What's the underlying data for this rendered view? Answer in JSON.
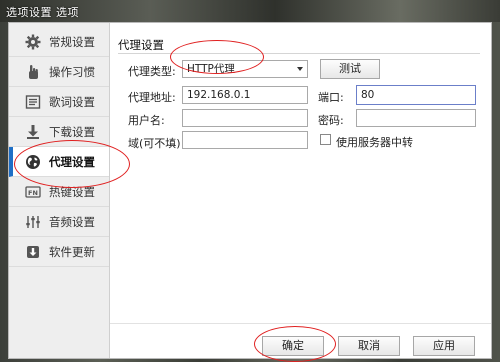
{
  "window": {
    "title": "选项设置 选项"
  },
  "sidebar": {
    "items": [
      {
        "label": "常规设置",
        "icon": "gear-icon"
      },
      {
        "label": "操作习惯",
        "icon": "hand-icon"
      },
      {
        "label": "歌词设置",
        "icon": "lyrics-icon"
      },
      {
        "label": "下载设置",
        "icon": "download-icon"
      },
      {
        "label": "代理设置",
        "icon": "globe-icon"
      },
      {
        "label": "热键设置",
        "icon": "hotkey-icon"
      },
      {
        "label": "音频设置",
        "icon": "equalizer-icon"
      },
      {
        "label": "软件更新",
        "icon": "update-icon"
      }
    ],
    "active_index": 4,
    "accent_color": "#1f6fc6"
  },
  "proxy": {
    "section_title": "代理设置",
    "type_label": "代理类型:",
    "type_value": "HTTP代理",
    "test_button": "测试",
    "address_label": "代理地址:",
    "address_value": "192.168.0.1",
    "port_label": "端口:",
    "port_value": "80",
    "username_label": "用户名:",
    "username_value": "",
    "password_label": "密码:",
    "password_value": "",
    "domain_label": "域(可不填)",
    "domain_value": "",
    "server_relay_label": "使用服务器中转",
    "server_relay_checked": false
  },
  "footer": {
    "ok_button": "确定",
    "cancel_button": "取消",
    "apply_button": "应用"
  },
  "annotation_color": "#e02020"
}
